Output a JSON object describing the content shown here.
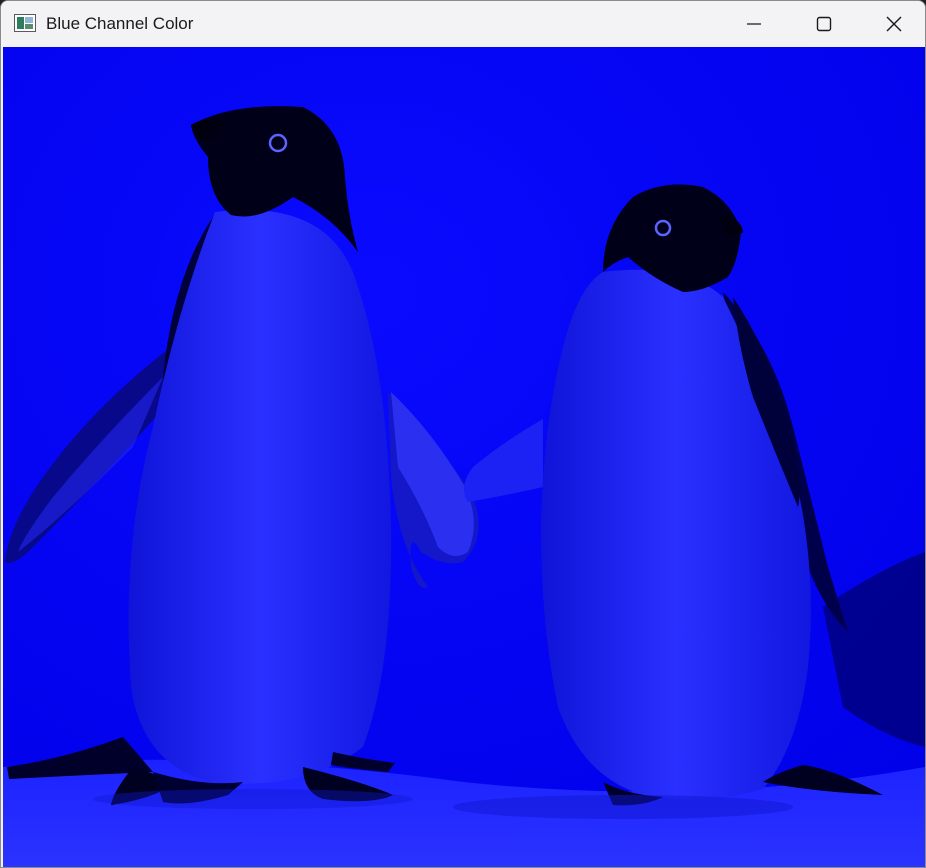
{
  "window": {
    "title": "Blue Channel Color"
  },
  "titlebar": {
    "app_icon": "app-window-icon",
    "minimize_icon": "minimize-icon",
    "maximize_icon": "maximize-icon",
    "close_icon": "close-icon"
  },
  "image": {
    "subject": "two penguins",
    "channel_tint": "#0000f0",
    "shadow_color": "#000018",
    "body_color": "#1e24ff"
  }
}
